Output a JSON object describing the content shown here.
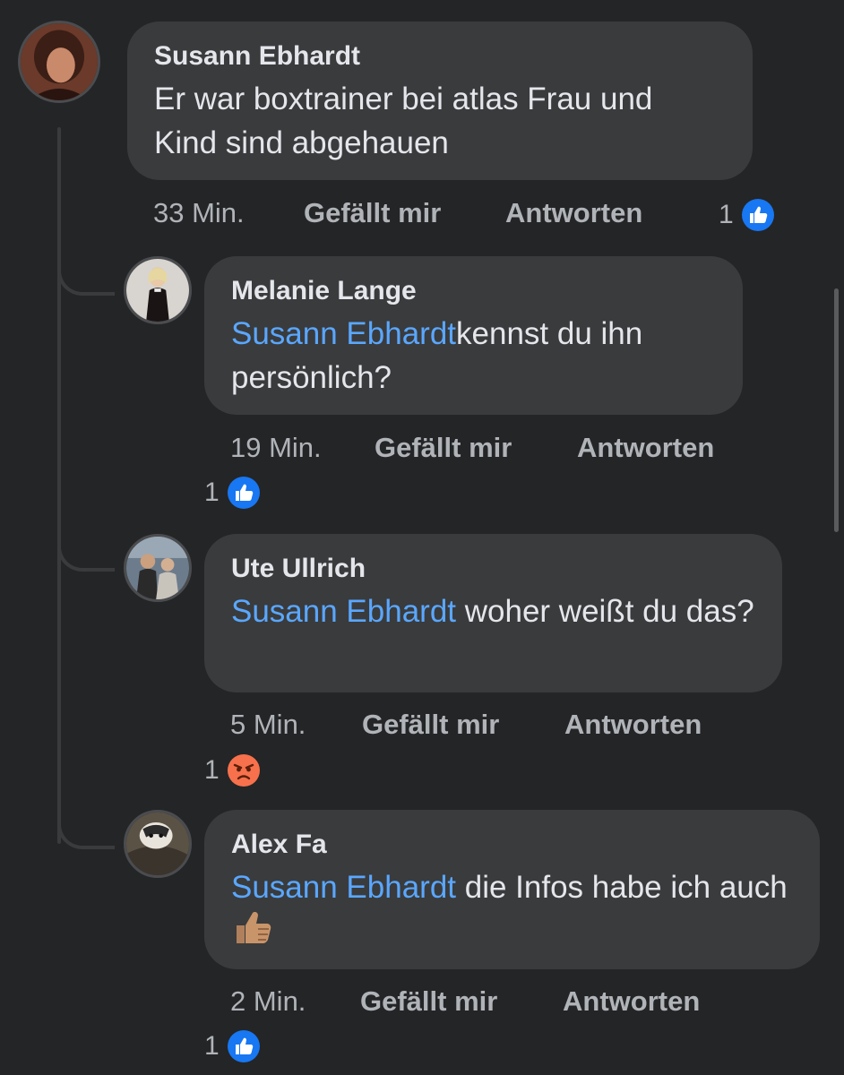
{
  "comment": {
    "author": "Susann Ebhardt",
    "text": "Er war boxtrainer bei atlas Frau und Kind sind abgehauen",
    "time": "33 Min.",
    "like_label": "Gefällt mir",
    "reply_label": "Antworten",
    "reaction_count": "1",
    "reaction_icon": "like-icon"
  },
  "replies": [
    {
      "author": "Melanie Lange",
      "mention": "Susann Ebhardt",
      "text": "kennst du ihn persönlich?",
      "time": "19 Min.",
      "like_label": "Gefällt mir",
      "reply_label": "Antworten",
      "reaction_count": "1",
      "reaction_icon": "like-icon"
    },
    {
      "author": "Ute Ullrich",
      "mention": "Susann Ebhardt",
      "text": " woher weißt du das?",
      "time": "5 Min.",
      "like_label": "Gefällt mir",
      "reply_label": "Antworten",
      "reaction_count": "1",
      "reaction_icon": "angry-icon"
    },
    {
      "author": "Alex Fa",
      "mention": "Susann Ebhardt",
      "text": " die Infos habe ich auch",
      "emoji": "thumbs-up-emoji",
      "time": "2 Min.",
      "like_label": "Gefällt mir",
      "reply_label": "Antworten",
      "reaction_count": "1",
      "reaction_icon": "like-icon"
    }
  ],
  "colors": {
    "background": "#242526",
    "bubble": "#3a3b3c",
    "mention": "#5aa7ff",
    "like_blue": "#1877f2",
    "angry_orange": "#f7714c"
  }
}
